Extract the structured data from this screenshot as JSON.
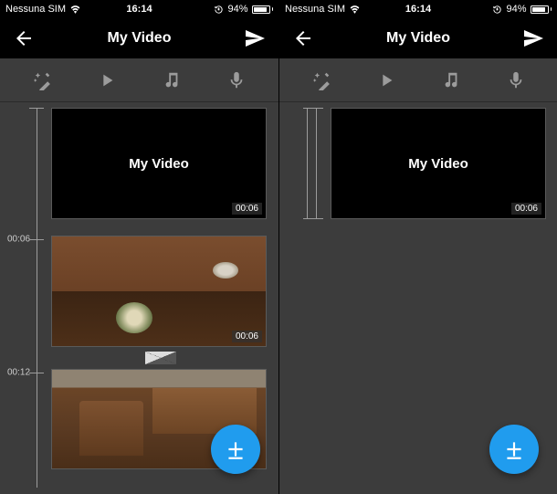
{
  "status": {
    "carrier": "Nessuna SIM",
    "time": "16:14",
    "battery_pct": "94%"
  },
  "header": {
    "title": "My Video"
  },
  "title_card": {
    "text": "My Video",
    "duration": "00:06"
  },
  "clip2": {
    "duration": "00:06"
  },
  "timeline": {
    "t1": "00:06",
    "t2": "00:12"
  }
}
